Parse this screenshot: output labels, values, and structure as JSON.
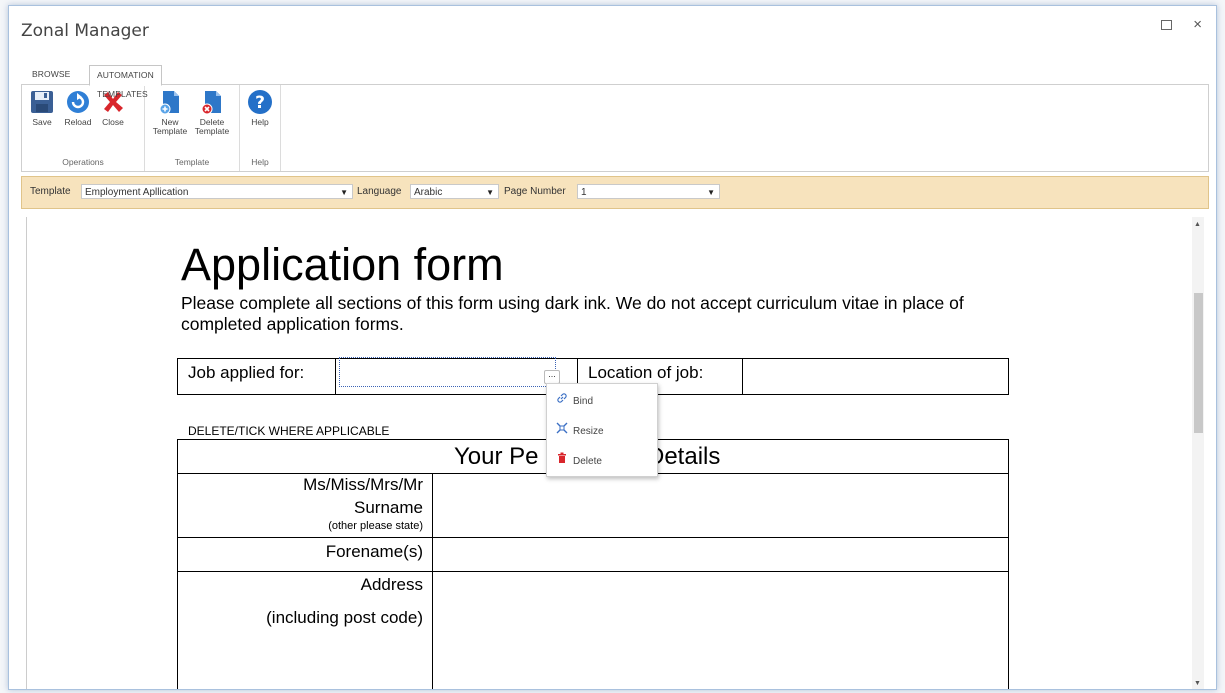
{
  "window": {
    "title": "Zonal Manager",
    "maximize_icon": "maximize-icon",
    "close_icon": "close-icon",
    "close_glyph": "×"
  },
  "tabs": [
    {
      "label": "BROWSE"
    },
    {
      "label": "AUTOMATION TEMPLATES"
    }
  ],
  "ribbon": {
    "groups": [
      {
        "label": "Operations",
        "buttons": [
          {
            "label": "Save",
            "icon": "save-icon"
          },
          {
            "label": "Reload",
            "icon": "reload-icon"
          },
          {
            "label": "Close",
            "icon": "close-x-icon"
          }
        ]
      },
      {
        "label": "Template",
        "buttons": [
          {
            "label": "New Template",
            "icon": "new-template-icon"
          },
          {
            "label": "Delete Template",
            "icon": "delete-template-icon"
          }
        ]
      },
      {
        "label": "Help",
        "buttons": [
          {
            "label": "Help",
            "icon": "help-icon"
          }
        ]
      }
    ]
  },
  "filters": {
    "template_label": "Template",
    "template_value": "Employment Apllication",
    "language_label": "Language",
    "language_value": "Arabic",
    "page_label": "Page Number",
    "page_value": "1",
    "arrow": "▼"
  },
  "document": {
    "title": "Application form",
    "instructions": "Please complete all sections of this form using dark ink. We do not accept curriculum vitae in place of completed application forms.",
    "job_applied_label": "Job applied for:",
    "location_label": "Location of job:",
    "delete_tick": "DELETE/TICK WHERE APPLICABLE",
    "section_title_left": "Your Pe",
    "section_title_right": "Details",
    "title_field": "Ms/Miss/Mrs/Mr",
    "surname": "Surname",
    "other_state": "(other please state)",
    "forenames": "Forename(s)",
    "address": "Address",
    "postcode": "(including post code)"
  },
  "field_handle": "...",
  "context_menu": [
    {
      "label": "Bind",
      "icon": "link-icon"
    },
    {
      "label": "Resize",
      "icon": "resize-icon"
    },
    {
      "label": "Delete",
      "icon": "trash-icon"
    }
  ],
  "colors": {
    "accent": "#1e6fd0",
    "filter_bg": "#f7e3bd",
    "delete_red": "#d9262c"
  }
}
